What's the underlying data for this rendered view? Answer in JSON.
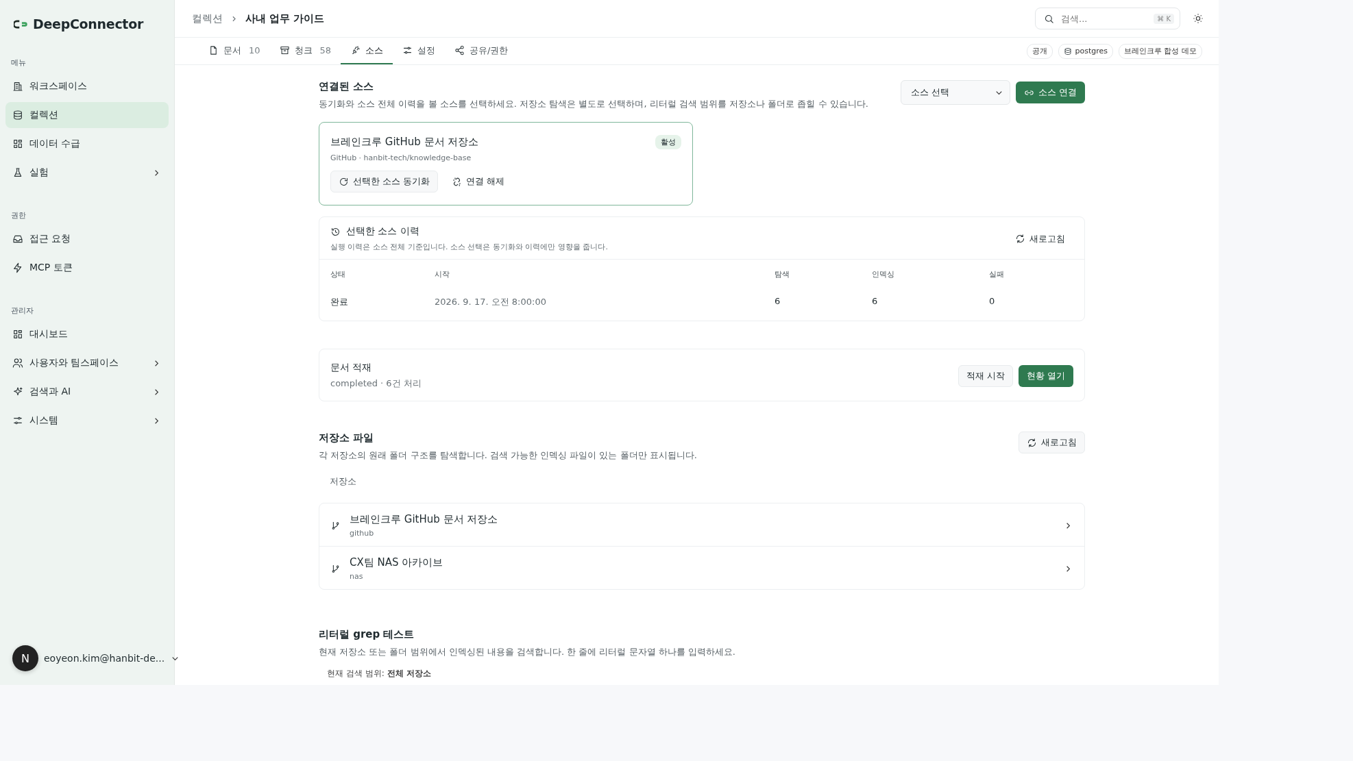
{
  "app": {
    "name": "DeepConnector"
  },
  "sidebar": {
    "sections": [
      {
        "heading": "메뉴",
        "items": [
          {
            "label": "워크스페이스",
            "kind": "building",
            "selected": false,
            "expandable": false
          },
          {
            "label": "컬렉션",
            "kind": "database",
            "selected": true,
            "expandable": false
          },
          {
            "label": "데이터 수급",
            "kind": "grid",
            "selected": false,
            "expandable": false
          },
          {
            "label": "실험",
            "kind": "flask",
            "selected": false,
            "expandable": true
          }
        ]
      },
      {
        "heading": "권한",
        "items": [
          {
            "label": "접근 요청",
            "kind": "inbox",
            "selected": false,
            "expandable": false
          },
          {
            "label": "MCP 토큰",
            "kind": "bolt",
            "selected": false,
            "expandable": false
          }
        ]
      },
      {
        "heading": "관리자",
        "items": [
          {
            "label": "대시보드",
            "kind": "grid",
            "selected": false,
            "expandable": false
          },
          {
            "label": "사용자와 팀스페이스",
            "kind": "users",
            "selected": false,
            "expandable": true
          },
          {
            "label": "검색과 AI",
            "kind": "sparkle",
            "selected": false,
            "expandable": true
          },
          {
            "label": "시스템",
            "kind": "sliders",
            "selected": false,
            "expandable": true
          }
        ]
      }
    ],
    "user": {
      "avatar": "N",
      "email": "eoyeon.kim@hanbit-de..."
    }
  },
  "header": {
    "breadcrumb": [
      "컬렉션",
      "사내 업무 가이드"
    ],
    "search": {
      "placeholder": "검색...",
      "shortcut": "⌘ K"
    }
  },
  "tabs": [
    {
      "label": "문서",
      "count": "10",
      "kind": "file",
      "selected": false
    },
    {
      "label": "청크",
      "count": "58",
      "kind": "archive",
      "selected": false
    },
    {
      "label": "소스",
      "kind": "plug",
      "selected": true
    },
    {
      "label": "설정",
      "kind": "sliders",
      "selected": false
    },
    {
      "label": "공유/권한",
      "kind": "share",
      "selected": false
    }
  ],
  "tags": [
    {
      "label": "공개",
      "kind": "plain"
    },
    {
      "label": "postgres",
      "kind": "database"
    },
    {
      "label": "브레인크루 합성 데모",
      "kind": "plain"
    }
  ],
  "connected": {
    "title": "연결된 소스",
    "description": "동기화와 소스 전체 이력을 볼 소스를 선택하세요. 저장소 탐색은 별도로 선택하며, 리터럴 검색 범위를 저장소나 폴더로 좁힐 수 있습니다.",
    "select": {
      "placeholder": "소스 선택"
    },
    "connect_button": "소스 연결",
    "sources": [
      {
        "name": "브레인크루 GitHub 문서 저장소",
        "meta": "GitHub · hanbit-tech/knowledge-base",
        "badge": "활성",
        "selected": true,
        "actions": [
          "선택한 소스 동기화",
          "연결 해제"
        ]
      }
    ]
  },
  "history": {
    "title": "선택한 소스 이력",
    "description": "실행 이력은 소스 전체 기준입니다. 소스 선택은 동기화와 이력에만 영향을 줍니다.",
    "refresh": "새로고침",
    "columns": [
      "상태",
      "시작",
      "탐색",
      "인덱싱",
      "실패"
    ],
    "rows": [
      [
        "완료",
        "2026. 9. 17. 오전 8:00:00",
        "6",
        "6",
        "0"
      ]
    ]
  },
  "ingest": {
    "title": "문서 적재",
    "status": "completed · 6건 처리",
    "buttons": [
      "적재 시작",
      "현황 열기"
    ]
  },
  "repo_files": {
    "title": "저장소 파일",
    "description": "각 저장소의 원래 폴더 구조를 탐색합니다. 검색 가능한 인덱싱 파일이 있는 폴더만 표시됩니다.",
    "refresh": "새로고침",
    "list_label": "저장소",
    "repos": [
      {
        "name": "브레인크루 GitHub 문서 저장소",
        "type": "github"
      },
      {
        "name": "CX팀 NAS 아카이브",
        "type": "nas"
      }
    ]
  },
  "grep": {
    "title": "리터럴 grep 테스트",
    "description": "현재 저장소 또는 폴더 범위에서 인덱싱된 내용을 검색합니다. 한 줄에 리터럴 문자열 하나를 입력하세요.",
    "scope": "현재 검색 범위: **전체 저장소**"
  }
}
